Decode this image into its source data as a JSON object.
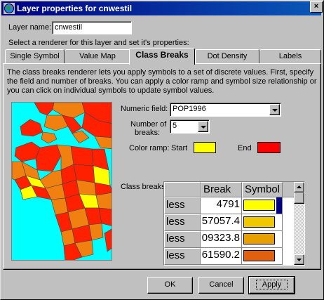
{
  "window": {
    "title": "Layer properties for cnwestil",
    "close_label": "×"
  },
  "layer_name": {
    "label": "Layer name:",
    "value": "cnwestil"
  },
  "instruction": "Select a renderer for this layer and set it's properties:",
  "tabs": [
    {
      "label": "Single Symbol"
    },
    {
      "label": "Value Map"
    },
    {
      "label": "Class Breaks",
      "active": true
    },
    {
      "label": "Dot Density"
    },
    {
      "label": "Labels"
    }
  ],
  "description": "The class breaks renderer lets you apply symbols to a set of discrete values. First, specify the field and number of breaks. You can apply a color ramp and symbol size relationship or you can click on individual symbols to update symbol values.",
  "numeric_field": {
    "label": "Numeric field:",
    "value": "POP1996"
  },
  "number_of_breaks": {
    "label_line1": "Number of",
    "label_line2": "breaks:",
    "value": "5"
  },
  "color_ramp": {
    "label": "Color ramp:",
    "start_label": "Start",
    "start_color": "#ffff00",
    "end_label": "End",
    "end_color": "#ff0000"
  },
  "class_breaks": {
    "label": "Class breaks:",
    "headers": {
      "break": "Break",
      "symbol": "Symbol"
    },
    "rows": [
      {
        "prefix": "less",
        "value": "4791",
        "color": "#ffff00"
      },
      {
        "prefix": "less",
        "value": "57057.4",
        "color": "#f0c800"
      },
      {
        "prefix": "less",
        "value": "09323.8",
        "color": "#e8a000"
      },
      {
        "prefix": "less",
        "value": "61590.2",
        "color": "#e06010"
      }
    ]
  },
  "buttons": {
    "ok": "OK",
    "cancel": "Cancel",
    "apply": "Apply"
  },
  "colors": {
    "window_bg": "#c0c0c0",
    "title_bar": "#000080",
    "map_sea": "#00ffff",
    "map_red": "#ff2000",
    "map_orange": "#f08010"
  }
}
